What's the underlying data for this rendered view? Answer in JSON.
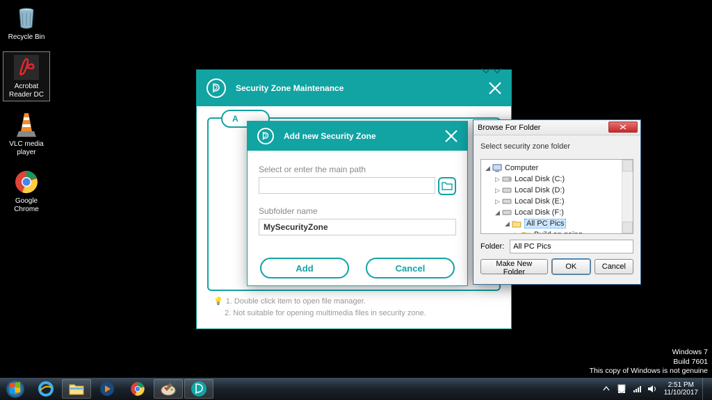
{
  "desktop": {
    "icons": [
      {
        "name": "recycle-bin",
        "label": "Recycle Bin"
      },
      {
        "name": "acrobat-reader",
        "label": "Acrobat Reader DC"
      },
      {
        "name": "vlc",
        "label": "VLC media player"
      },
      {
        "name": "chrome",
        "label": "Google Chrome"
      }
    ]
  },
  "main_window": {
    "title": "Security Zone Maintenance",
    "add_button": "A",
    "tips": {
      "line1": "1. Double click item to open file manager.",
      "line2": "2. Not suitable for opening multimedia files in security zone."
    }
  },
  "add_window": {
    "title": "Add new Security Zone",
    "path_label": "Select or enter the main path",
    "path_value": "",
    "subfolder_label": "Subfolder name",
    "subfolder_value": "MySecurityZone",
    "add_btn": "Add",
    "cancel_btn": "Cancel"
  },
  "browse_window": {
    "title": "Browse For Folder",
    "instruction": "Select security zone folder",
    "tree": {
      "root": "Computer",
      "items": [
        {
          "label": "Local Disk (C:)",
          "depth": 1,
          "expanded": false,
          "type": "disk"
        },
        {
          "label": "Local Disk (D:)",
          "depth": 1,
          "expanded": false,
          "type": "disk"
        },
        {
          "label": "Local Disk (E:)",
          "depth": 1,
          "expanded": false,
          "type": "disk"
        },
        {
          "label": "Local Disk (F:)",
          "depth": 1,
          "expanded": true,
          "type": "disk"
        },
        {
          "label": "All PC Pics",
          "depth": 2,
          "expanded": true,
          "type": "folder",
          "selected": true
        },
        {
          "label": "Build on going",
          "depth": 3,
          "expanded": false,
          "type": "folder"
        }
      ]
    },
    "folder_label": "Folder:",
    "folder_value": "All PC Pics",
    "make_folder_btn": "Make New Folder",
    "ok_btn": "OK",
    "cancel_btn": "Cancel"
  },
  "watermark": {
    "line1": "Windows 7",
    "line2": "Build 7601",
    "line3": "This copy of Windows is not genuine"
  },
  "taskbar": {
    "clock_time": "2:51 PM",
    "clock_date": "11/10/2017"
  }
}
